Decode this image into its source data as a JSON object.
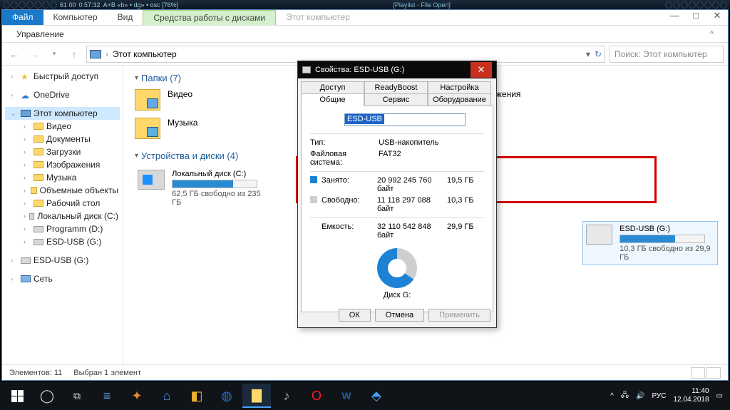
{
  "player": {
    "title": "[Playlist - File Open]",
    "time": "0:57:32",
    "info": "A+B «b» • dg» • osc [76%]",
    "num": "61    00"
  },
  "explorer": {
    "tabs": {
      "file": "Файл",
      "computer": "Компьютер",
      "view": "Вид",
      "tools": "Средства работы с дисками",
      "context": "Этот компьютер"
    },
    "ribbon_item": "Управление",
    "breadcrumb": "Этот компьютер",
    "search_placeholder": "Поиск: Этот компьютер"
  },
  "sidebar": {
    "quick": "Быстрый доступ",
    "onedrive": "OneDrive",
    "pc": "Этот компьютер",
    "pc_children": [
      "Видео",
      "Документы",
      "Загрузки",
      "Изображения",
      "Музыка",
      "Объемные объекты",
      "Рабочий стол",
      "Локальный диск (C:)",
      "Programm (D:)",
      "ESD-USB (G:)"
    ],
    "esd": "ESD-USB (G:)",
    "network": "Сеть"
  },
  "content": {
    "folders_hdr": "Папки (7)",
    "folders": [
      "Видео",
      "Музыка",
      "Изображения"
    ],
    "drives_hdr": "Устройства и диски (4)",
    "c": {
      "name": "Локальный диск (C:)",
      "free": "62,5 ГБ свободно из 235 ГБ",
      "pct": 72
    },
    "g": {
      "name": "ESD-USB (G:)",
      "free": "10,3 ГБ свободно из 29,9 ГБ",
      "pct": 65
    }
  },
  "props": {
    "title": "Свойства: ESD-USB (G:)",
    "tabs": {
      "access": "Доступ",
      "readyboost": "ReadyBoost",
      "settings": "Настройка",
      "general": "Общие",
      "service": "Сервис",
      "hardware": "Оборудование"
    },
    "name_value": "ESD-USB",
    "type_k": "Тип:",
    "type_v": "USB-накопитель",
    "fs_k": "Файловая система:",
    "fs_v": "FAT32",
    "used_k": "Занято:",
    "used_b": "20 992 245 760 байт",
    "used_g": "19,5 ГБ",
    "free_k": "Свободно:",
    "free_b": "11 118 297 088 байт",
    "free_g": "10,3 ГБ",
    "cap_k": "Емкость:",
    "cap_b": "32 110 542 848 байт",
    "cap_g": "29,9 ГБ",
    "disk_label": "Диск G:",
    "ok": "ОК",
    "cancel": "Отмена",
    "apply": "Применить"
  },
  "status": {
    "count": "Элементов: 11",
    "sel": "Выбран 1 элемент"
  },
  "tray": {
    "lang": "РУС",
    "time": "11:40",
    "date": "12.04.2018"
  }
}
